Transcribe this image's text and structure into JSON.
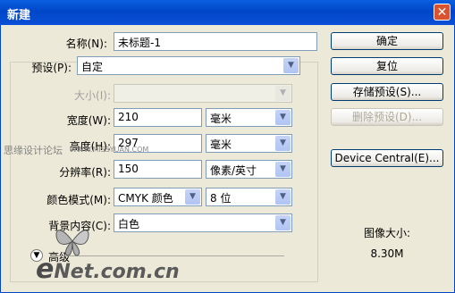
{
  "window": {
    "title": "新建"
  },
  "form": {
    "name_label": "名称(N):",
    "name_value": "未标题-1",
    "preset_label": "预设(P):",
    "preset_value": "自定",
    "size_label": "大小(I):",
    "size_value": "",
    "width_label": "宽度(W):",
    "width_value": "210",
    "width_unit": "毫米",
    "height_label": "高度(H):",
    "height_value": "297",
    "height_unit": "毫米",
    "resolution_label": "分辨率(R):",
    "resolution_value": "150",
    "resolution_unit": "像素/英寸",
    "color_mode_label": "颜色模式(M):",
    "color_mode_value": "CMYK 颜色",
    "bit_depth_value": "8 位",
    "background_label": "背景内容(C):",
    "background_value": "白色",
    "advanced_label": "高级"
  },
  "buttons": {
    "ok": "确定",
    "reset": "复位",
    "save_preset": "存储预设(S)...",
    "delete_preset": "删除预设(D)...",
    "device_central": "Device Central(E)..."
  },
  "image_size": {
    "label": "图像大小:",
    "value": "8.30M"
  },
  "watermarks": {
    "forum": "思缘设计论坛",
    "site": "WWW.MISSYUAN.COM",
    "brand_e": "e",
    "brand_rest": "Net.com.cn"
  }
}
